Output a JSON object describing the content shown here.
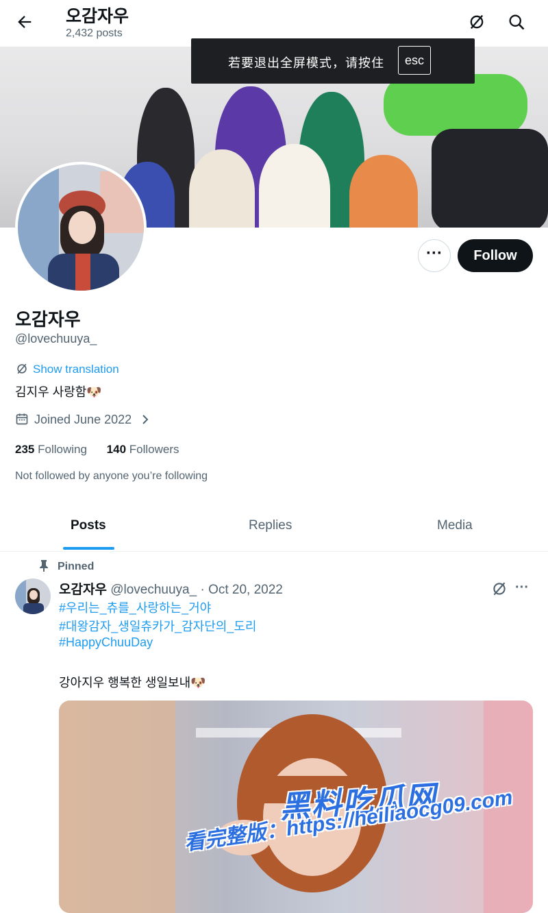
{
  "header": {
    "title": "오감자우",
    "posts_count": "2,432 posts",
    "icons": [
      "back-arrow-icon",
      "translate-icon",
      "search-icon"
    ]
  },
  "toast": {
    "text": "若要退出全屏模式，请按住",
    "key": "esc"
  },
  "profile": {
    "more_label": "···",
    "follow_label": "Follow",
    "name": "오감자우",
    "handle": "@lovechuuya_",
    "show_translation": "Show translation",
    "bio": "김지우 사랑함🐶",
    "joined": "Joined June 2022",
    "following_count": "235",
    "following_label": "Following",
    "followers_count": "140",
    "followers_label": "Followers",
    "not_followed": "Not followed by anyone you’re following"
  },
  "tabs": [
    {
      "label": "Posts",
      "active": true
    },
    {
      "label": "Replies",
      "active": false
    },
    {
      "label": "Media",
      "active": false
    }
  ],
  "tweet": {
    "pinned_label": "Pinned",
    "author_name": "오감자우",
    "author_handle": "@lovechuuya_",
    "date": "· Oct 20, 2022",
    "hashtags": [
      "#우리는_츄를_사랑하는_거야",
      "#대왕감자_생일츄카가_감자단의_도리",
      "#HappyChuuDay"
    ],
    "text": "강아지우 행복한 생일보내🐶",
    "more_label": "···"
  },
  "watermark": {
    "line1": "黑料吃瓜网",
    "line2": "看完整版：https://heiliaocg09.com"
  },
  "colors": {
    "accent": "#1d9bf0",
    "text": "#0f1419",
    "muted": "#536471",
    "button_dark": "#0f1419"
  }
}
